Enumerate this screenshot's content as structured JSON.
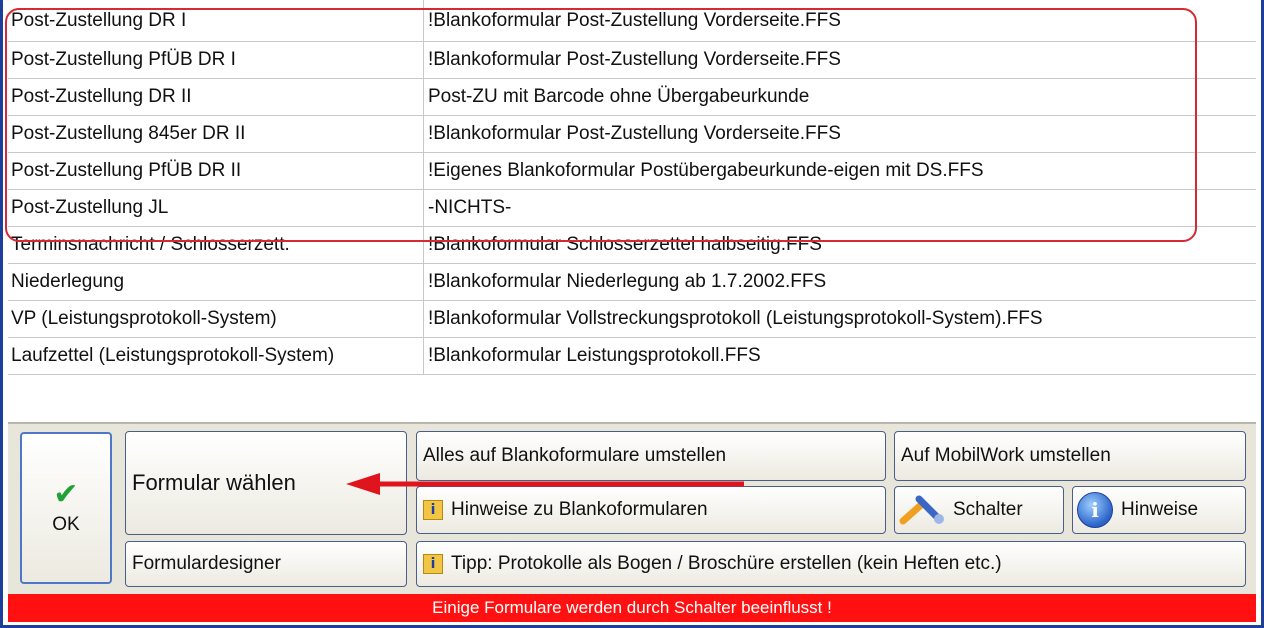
{
  "rows": [
    {
      "name": "Post-Zustellung DR I",
      "form": "!Blankoformular Post-Zustellung Vorderseite.FFS"
    },
    {
      "name": "Post-Zustellung PfÜB DR I",
      "form": "!Blankoformular Post-Zustellung Vorderseite.FFS"
    },
    {
      "name": "Post-Zustellung DR II",
      "form": "Post-ZU mit Barcode ohne Übergabeurkunde"
    },
    {
      "name": "Post-Zustellung 845er DR II",
      "form": "!Blankoformular Post-Zustellung Vorderseite.FFS"
    },
    {
      "name": "Post-Zustellung PfÜB DR II",
      "form": "!Eigenes Blankoformular Postübergabeurkunde-eigen mit DS.FFS"
    },
    {
      "name": "Post-Zustellung JL",
      "form": "-NICHTS-"
    },
    {
      "name": "Terminsnachricht / Schlosserzett.",
      "form": "!Blankoformular Schlosserzettel halbseitig.FFS"
    },
    {
      "name": "Niederlegung",
      "form": "!Blankoformular Niederlegung ab 1.7.2002.FFS"
    },
    {
      "name": "VP (Leistungsprotokoll-System)",
      "form": "!Blankoformular Vollstreckungsprotokoll (Leistungsprotokoll-System).FFS"
    },
    {
      "name": "Laufzettel (Leistungsprotokoll-System)",
      "form": "!Blankoformular Leistungsprotokoll.FFS"
    }
  ],
  "buttons": {
    "ok": "OK",
    "formular_waehlen": "Formular wählen",
    "formulardesigner": "Formulardesigner",
    "alles_blanko": "Alles auf Blankoformulare umstellen",
    "hinweise_blanko": "Hinweise zu Blankoformularen",
    "tipp": "Tipp: Protokolle als Bogen / Broschüre erstellen (kein Heften etc.)",
    "mobilwork": "Auf MobilWork umstellen",
    "schalter": "Schalter",
    "hinweise": "Hinweise"
  },
  "status_text": "Einige Formulare werden durch Schalter beeinflusst !",
  "icons": {
    "ok": "checkmark-icon",
    "hint": "info-page-icon",
    "schalter": "wrench-icon",
    "hinweise": "info-circle-icon"
  },
  "colors": {
    "frame": "#1c3f9c",
    "highlight": "#d42a33",
    "status_bg": "#ff1111",
    "arrow": "#e0141c",
    "check": "#22a236"
  }
}
